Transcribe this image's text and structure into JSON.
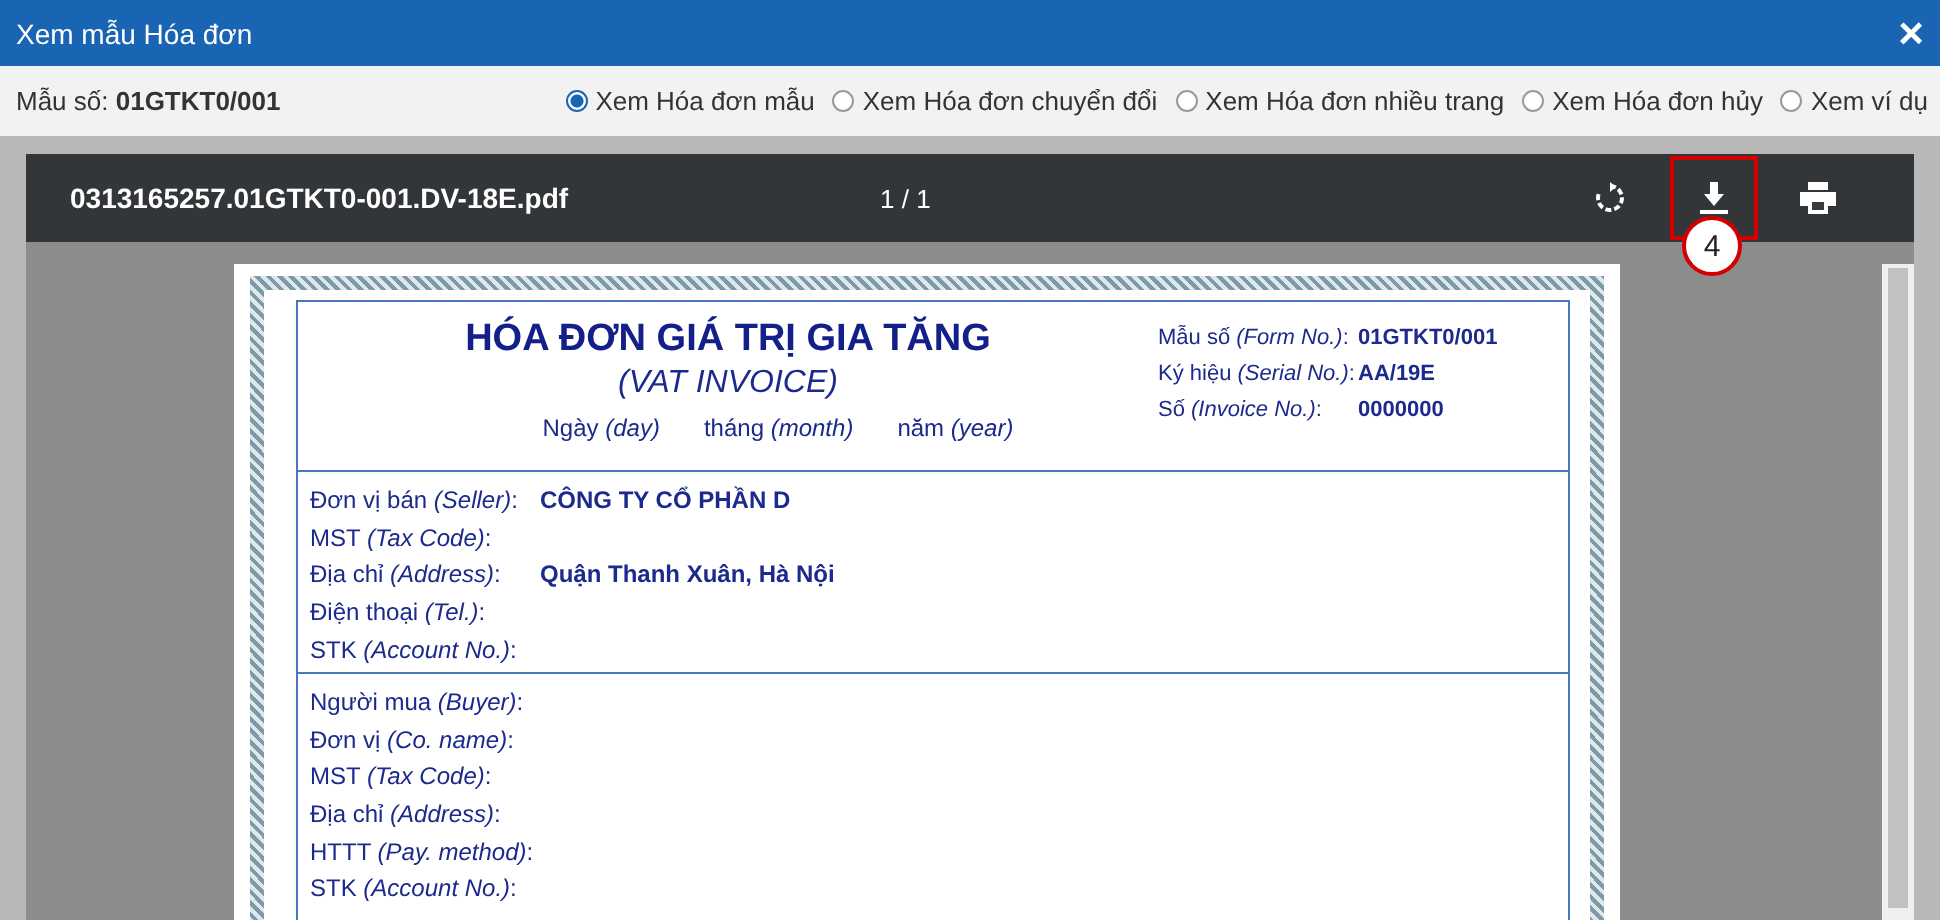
{
  "window": {
    "title": "Xem mẫu Hóa đơn",
    "close": "×"
  },
  "toolbar": {
    "form_label": "Mẫu số:",
    "form_value": "01GTKT0/001",
    "options": [
      {
        "label": "Xem Hóa đơn mẫu",
        "selected": true
      },
      {
        "label": "Xem Hóa đơn chuyển đổi",
        "selected": false
      },
      {
        "label": "Xem Hóa đơn nhiều trang",
        "selected": false
      },
      {
        "label": "Xem Hóa đơn hủy",
        "selected": false
      },
      {
        "label": "Xem ví dụ",
        "selected": false
      }
    ]
  },
  "viewer": {
    "filename": "0313165257.01GTKT0-001.DV-18E.pdf",
    "pages": "1 / 1",
    "callout": "4"
  },
  "invoice": {
    "title": "HÓA ĐƠN GIÁ TRỊ GIA TĂNG",
    "subtitle": "(VAT INVOICE)",
    "date": [
      "Ngày *(day)*",
      "tháng *(month)*",
      "năm *(year)*"
    ],
    "meta": [
      {
        "label": "Mẫu số *(Form No.)*:",
        "value": "01GTKT0/001"
      },
      {
        "label": "Ký hiệu *(Serial No.)*:",
        "value": "AA/19E"
      },
      {
        "label": "Số *(Invoice No.)*:",
        "value": "0000000"
      }
    ],
    "seller": [
      {
        "label": "Đơn vị bán *(Seller)*:",
        "value": "CÔNG TY CỔ PHẦN D"
      },
      {
        "label": "MST *(Tax Code)*:"
      },
      {
        "label": "Địa chỉ *(Address)*:",
        "value": "Quận Thanh Xuân, Hà Nội"
      },
      {
        "label": "Điện thoại *(Tel.)*:"
      },
      {
        "label": "STK *(Account No.)*:"
      }
    ],
    "buyer": [
      {
        "label": "Người mua *(Buyer)*:"
      },
      {
        "label": "Đơn vị *(Co. name)*:"
      },
      {
        "label": "MST *(Tax Code)*:"
      },
      {
        "label": "Địa chỉ *(Address)*:"
      },
      {
        "label": "HTTT *(Pay. method)*:"
      },
      {
        "label": "STK *(Account No.)*:"
      }
    ]
  }
}
